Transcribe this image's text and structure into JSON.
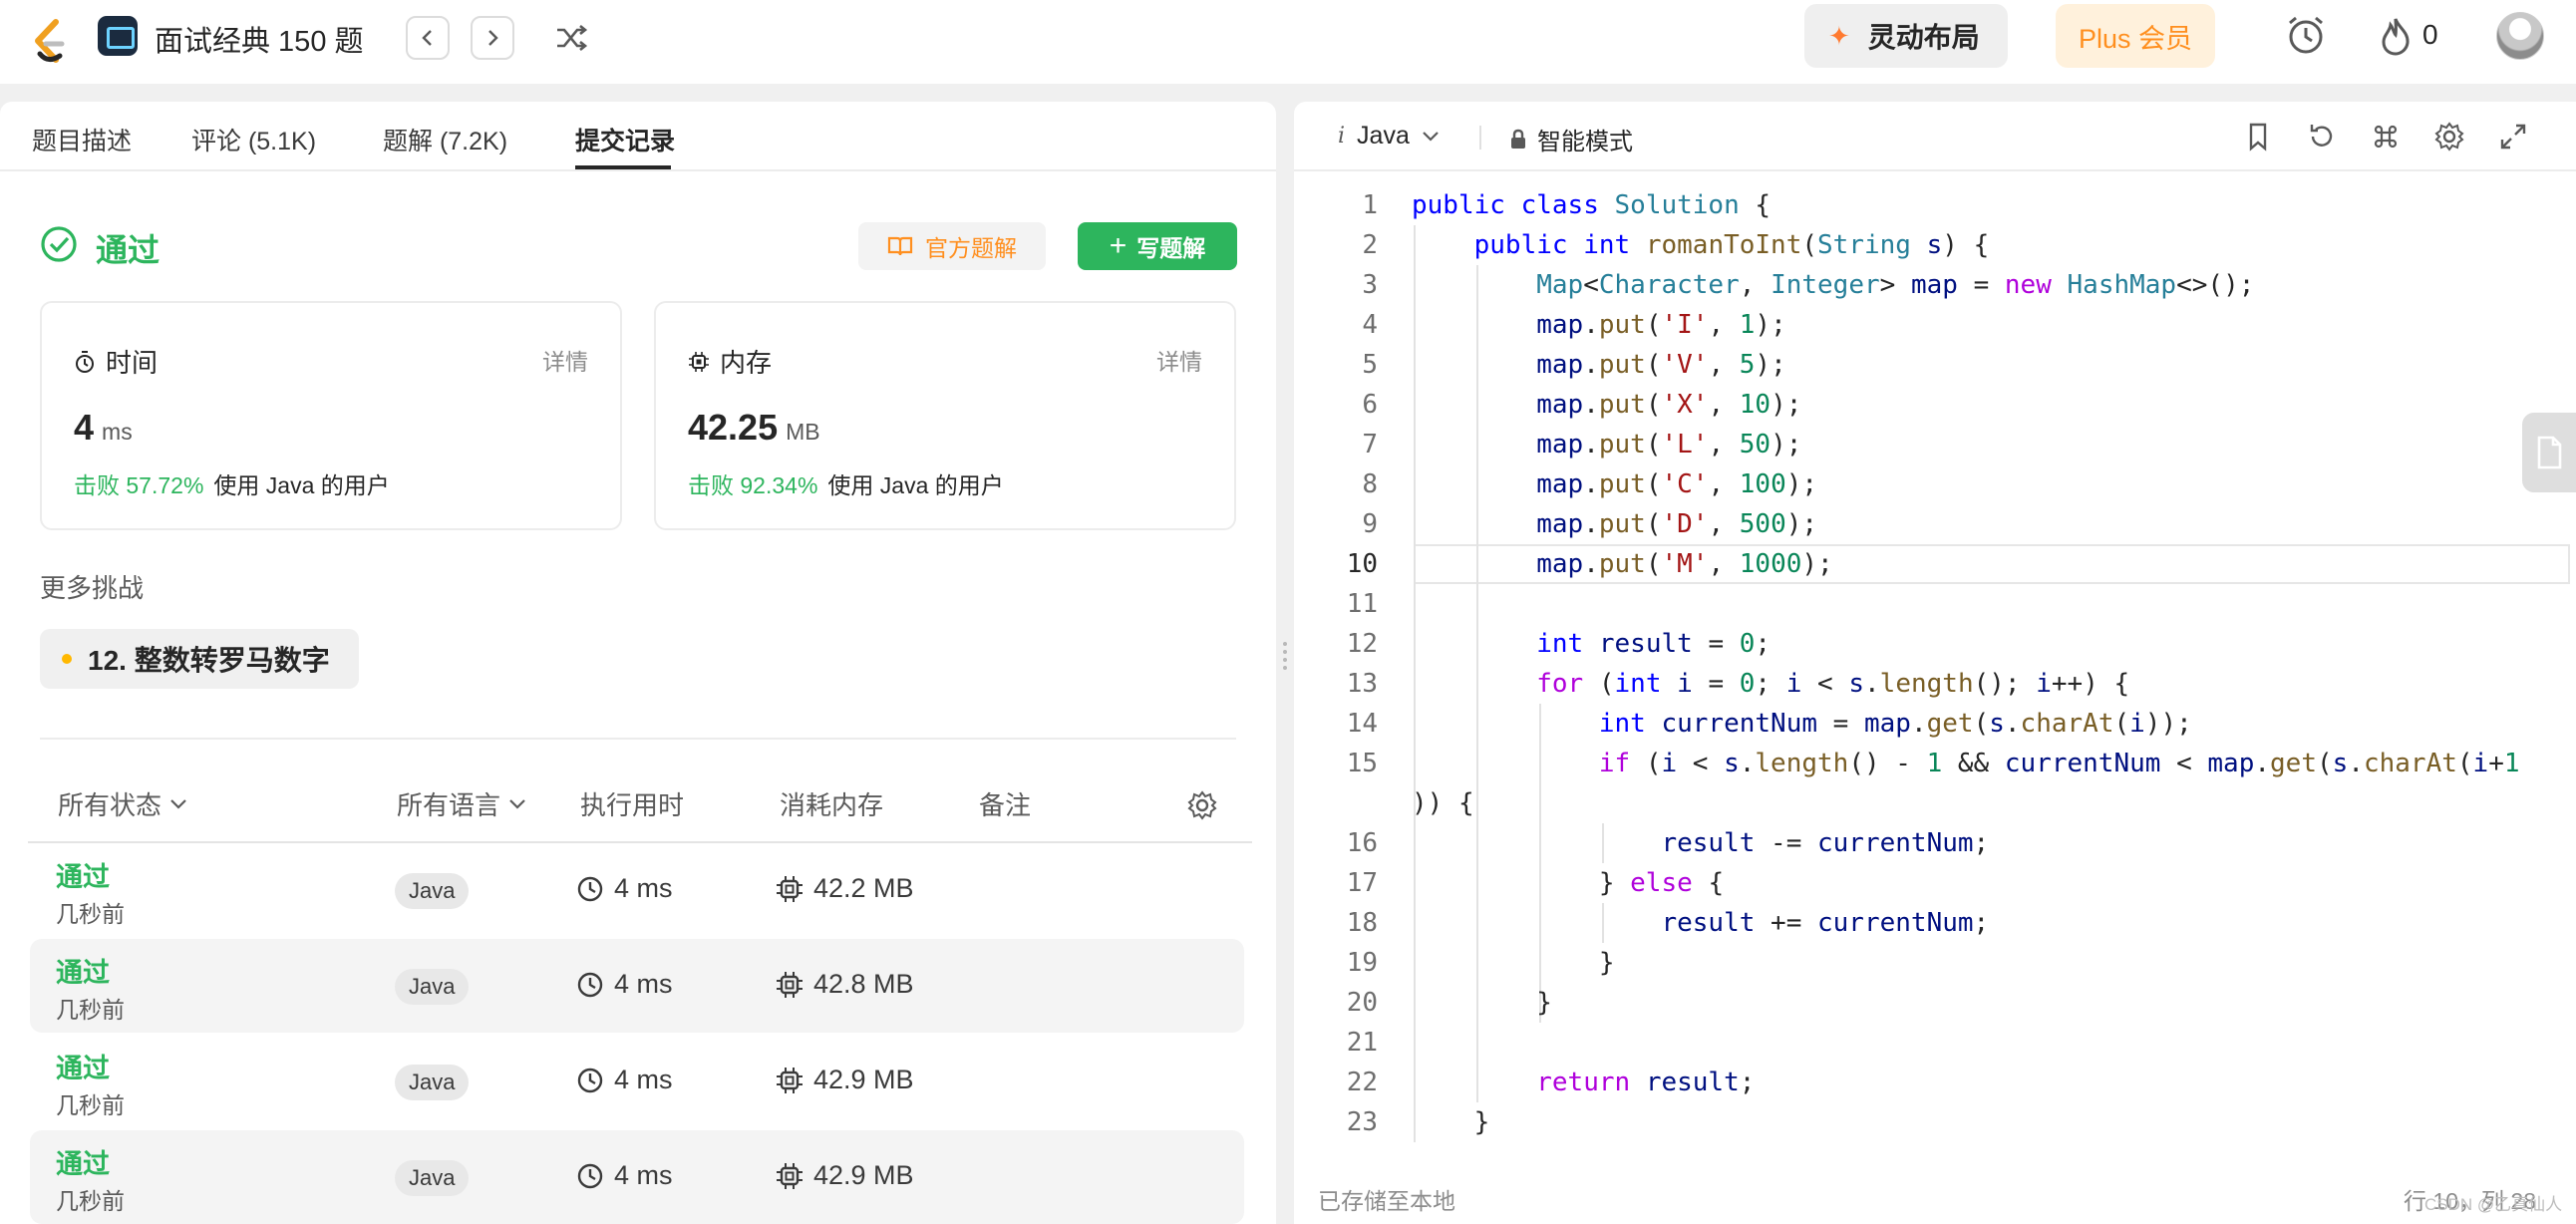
{
  "topbar": {
    "study_title": "面试经典 150 题",
    "layout_label": "灵动布局",
    "plus_label": "Plus 会员",
    "flame_count": "0"
  },
  "tabs": [
    {
      "label": "题目描述"
    },
    {
      "label": "评论 (5.1K)"
    },
    {
      "label": "题解 (7.2K)"
    },
    {
      "label": "提交记录",
      "active": true
    }
  ],
  "result": {
    "status": "通过",
    "official_solution": "官方题解",
    "write_solution": "写题解",
    "time": {
      "label": "时间",
      "detail": "详情",
      "value": "4",
      "unit": "ms",
      "beat_pct": "击败 57.72%",
      "beat_text": "使用 Java 的用户"
    },
    "memory": {
      "label": "内存",
      "detail": "详情",
      "value": "42.25",
      "unit": "MB",
      "beat_pct": "击败 92.34%",
      "beat_text": "使用 Java 的用户"
    }
  },
  "more": {
    "title": "更多挑战",
    "challenge": "12. 整数转罗马数字"
  },
  "table": {
    "headers": {
      "status": "所有状态",
      "language": "所有语言",
      "runtime": "执行用时",
      "memory": "消耗内存",
      "notes": "备注"
    },
    "rows": [
      {
        "status": "通过",
        "when": "几秒前",
        "lang": "Java",
        "runtime": "4 ms",
        "memory": "42.2 MB"
      },
      {
        "status": "通过",
        "when": "几秒前",
        "lang": "Java",
        "runtime": "4 ms",
        "memory": "42.8 MB"
      },
      {
        "status": "通过",
        "when": "几秒前",
        "lang": "Java",
        "runtime": "4 ms",
        "memory": "42.9 MB"
      },
      {
        "status": "通过",
        "when": "几秒前",
        "lang": "Java",
        "runtime": "4 ms",
        "memory": "42.9 MB"
      }
    ]
  },
  "editor": {
    "language": "Java",
    "mode": "智能模式",
    "saved": "已存储至本地",
    "cursor": "行 10，列 28",
    "code": [
      {
        "n": "1",
        "t": "public class Solution {"
      },
      {
        "n": "2",
        "t": "    public int romanToInt(String s) {"
      },
      {
        "n": "3",
        "t": "        Map<Character, Integer> map = new HashMap<>();"
      },
      {
        "n": "4",
        "t": "        map.put('I', 1);"
      },
      {
        "n": "5",
        "t": "        map.put('V', 5);"
      },
      {
        "n": "6",
        "t": "        map.put('X', 10);"
      },
      {
        "n": "7",
        "t": "        map.put('L', 50);"
      },
      {
        "n": "8",
        "t": "        map.put('C', 100);"
      },
      {
        "n": "9",
        "t": "        map.put('D', 500);"
      },
      {
        "n": "10",
        "t": "        map.put('M', 1000);"
      },
      {
        "n": "11",
        "t": ""
      },
      {
        "n": "12",
        "t": "        int result = 0;"
      },
      {
        "n": "13",
        "t": "        for (int i = 0; i < s.length(); i++) {"
      },
      {
        "n": "14",
        "t": "            int currentNum = map.get(s.charAt(i));"
      },
      {
        "n": "15",
        "t": "            if (i < s.length() - 1 && currentNum < map.get(s.charAt(i+1"
      },
      {
        "n": "",
        "t": ")) {"
      },
      {
        "n": "16",
        "t": "                result -= currentNum;"
      },
      {
        "n": "17",
        "t": "            } else {"
      },
      {
        "n": "18",
        "t": "                result += currentNum;"
      },
      {
        "n": "19",
        "t": "            }"
      },
      {
        "n": "20",
        "t": "        }"
      },
      {
        "n": "21",
        "t": ""
      },
      {
        "n": "22",
        "t": "        return result;"
      },
      {
        "n": "23",
        "t": "    }"
      }
    ]
  },
  "watermark": "CSDN @乙真仙人"
}
